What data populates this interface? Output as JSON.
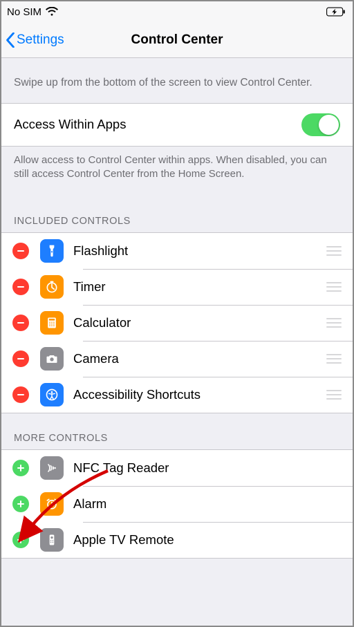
{
  "statusbar": {
    "carrier": "No SIM"
  },
  "nav": {
    "back_label": "Settings",
    "title": "Control Center"
  },
  "intro_text": "Swipe up from the bottom of the screen to view Control Center.",
  "access_row": {
    "label": "Access Within Apps"
  },
  "access_footer": "Allow access to Control Center within apps. When disabled, you can still access Control Center from the Home Screen.",
  "sections": {
    "included_header": "INCLUDED CONTROLS",
    "more_header": "MORE CONTROLS"
  },
  "included": [
    {
      "label": "Flashlight"
    },
    {
      "label": "Timer"
    },
    {
      "label": "Calculator"
    },
    {
      "label": "Camera"
    },
    {
      "label": "Accessibility Shortcuts"
    }
  ],
  "more": [
    {
      "label": "NFC Tag Reader"
    },
    {
      "label": "Alarm"
    },
    {
      "label": "Apple TV Remote"
    }
  ]
}
